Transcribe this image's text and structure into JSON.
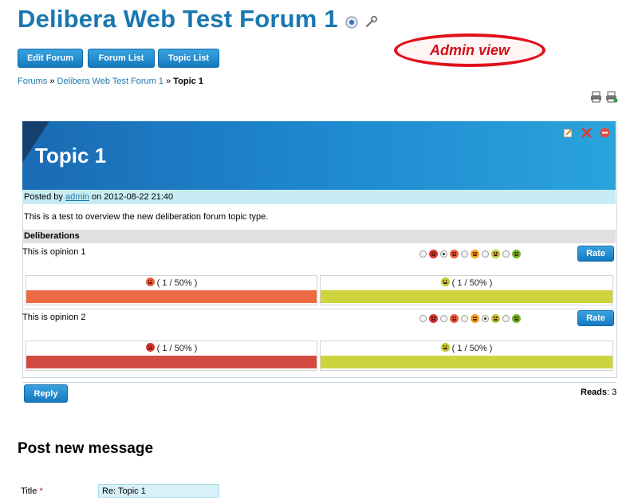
{
  "forum": {
    "title": "Delibera Web Test Forum 1",
    "help_icon": "help-icon",
    "settings_icon": "wrench-icon"
  },
  "toolbar": {
    "edit_forum": "Edit Forum",
    "forum_list": "Forum List",
    "topic_list": "Topic List"
  },
  "admin_label": "Admin view",
  "breadcrumb": {
    "forums": "Forums",
    "sep1": "»",
    "forum": "Delibera Web Test Forum 1",
    "sep2": "»",
    "current": "Topic 1"
  },
  "print_icons": [
    "print-icon",
    "print-preview-icon"
  ],
  "topic": {
    "title": "Topic 1",
    "admin_icons": [
      "edit-icon",
      "delete-icon",
      "block-icon"
    ],
    "posted_prefix": "Posted by",
    "author": "admin",
    "posted_suffix": "on 2012-08-22 21:40",
    "body": "This is a test to overview the new deliberation forum topic type."
  },
  "deliberations": {
    "heading": "Deliberations",
    "rate_label": "Rate",
    "scale": [
      "very-negative",
      "negative",
      "neutral",
      "positive",
      "very-positive"
    ],
    "opinions": [
      {
        "text": "This is opinion 1",
        "selected_index": 1,
        "results": [
          {
            "face": "negative",
            "label": "( 1 / 50% )",
            "fraction": 0.5,
            "color": "#ee6a44"
          },
          {
            "face": "positive",
            "label": "( 1 / 50% )",
            "fraction": 0.5,
            "color": "#cdd43e"
          }
        ]
      },
      {
        "text": "This is opinion 2",
        "selected_index": 3,
        "results": [
          {
            "face": "very-negative",
            "label": "( 1 / 50% )",
            "fraction": 0.5,
            "color": "#d24b42"
          },
          {
            "face": "positive",
            "label": "( 1 / 50% )",
            "fraction": 0.5,
            "color": "#cdd43e"
          }
        ]
      }
    ]
  },
  "reply_label": "Reply",
  "reads": {
    "label": "Reads",
    "value": "3"
  },
  "post_form": {
    "heading": "Post new message",
    "title_label": "Title",
    "required_mark": "*",
    "title_value": "Re: Topic 1"
  }
}
